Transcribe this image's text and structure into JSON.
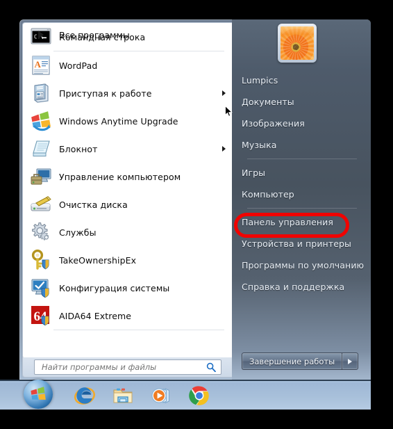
{
  "os": "Windows 7",
  "colors": {
    "accent_highlight": "#f00300",
    "menu_right_bg": "#4e5b6b",
    "menu_left_bg": "#ffffff",
    "taskbar_bg": "#a8c0da",
    "right_text": "#e7edf4"
  },
  "start_menu": {
    "programs": [
      {
        "label": "Командная строка",
        "icon": "command-prompt-icon",
        "submenu": false,
        "separator_after": true
      },
      {
        "label": "WordPad",
        "icon": "wordpad-icon",
        "submenu": false,
        "separator_after": false
      },
      {
        "label": "Приступая к работе",
        "icon": "getting-started-icon",
        "submenu": true,
        "separator_after": false
      },
      {
        "label": "Windows Anytime Upgrade",
        "icon": "windows-upgrade-icon",
        "submenu": false,
        "separator_after": false
      },
      {
        "label": "Блокнот",
        "icon": "notepad-icon",
        "submenu": true,
        "separator_after": false
      },
      {
        "label": "Управление компьютером",
        "icon": "computer-management-icon",
        "submenu": false,
        "separator_after": false
      },
      {
        "label": "Очистка диска",
        "icon": "disk-cleanup-icon",
        "submenu": false,
        "separator_after": false
      },
      {
        "label": "Службы",
        "icon": "services-icon",
        "submenu": false,
        "separator_after": false
      },
      {
        "label": "TakeOwnershipEx",
        "icon": "take-ownership-icon",
        "submenu": false,
        "separator_after": false
      },
      {
        "label": "Конфигурация системы",
        "icon": "msconfig-icon",
        "submenu": false,
        "separator_after": false
      },
      {
        "label": "AIDA64 Extreme",
        "icon": "aida64-icon",
        "submenu": false,
        "separator_after": true
      }
    ],
    "all_programs": {
      "label": "Все программы",
      "icon": "triangle-right-icon"
    },
    "search": {
      "placeholder": "Найти программы и файлы",
      "value": "",
      "icon": "search-icon"
    },
    "user": {
      "name": "Lumpics",
      "avatar": "sunflower-avatar"
    },
    "right_items": [
      {
        "label": "Lumpics",
        "separator_after": false,
        "highlighted": false
      },
      {
        "label": "Документы",
        "separator_after": false,
        "highlighted": false
      },
      {
        "label": "Изображения",
        "separator_after": false,
        "highlighted": false
      },
      {
        "label": "Музыка",
        "separator_after": true,
        "highlighted": false
      },
      {
        "label": "Игры",
        "separator_after": false,
        "highlighted": false
      },
      {
        "label": "Компьютер",
        "separator_after": true,
        "highlighted": false
      },
      {
        "label": "Панель управления",
        "separator_after": false,
        "highlighted": true
      },
      {
        "label": "Устройства и принтеры",
        "separator_after": false,
        "highlighted": false
      },
      {
        "label": "Программы по умолчанию",
        "separator_after": false,
        "highlighted": false
      },
      {
        "label": "Справка и поддержка",
        "separator_after": false,
        "highlighted": false
      }
    ],
    "shutdown": {
      "label": "Завершение работы",
      "arrow_icon": "triangle-right-icon"
    }
  },
  "taskbar": {
    "start_button": {
      "label": "Пуск",
      "icon": "windows-orb-icon"
    },
    "pinned": [
      {
        "name": "Internet Explorer",
        "icon": "internet-explorer-icon"
      },
      {
        "name": "Проводник",
        "icon": "windows-explorer-icon"
      },
      {
        "name": "Проигрыватель Windows Media",
        "icon": "windows-media-player-icon"
      },
      {
        "name": "Google Chrome",
        "icon": "google-chrome-icon"
      }
    ]
  }
}
